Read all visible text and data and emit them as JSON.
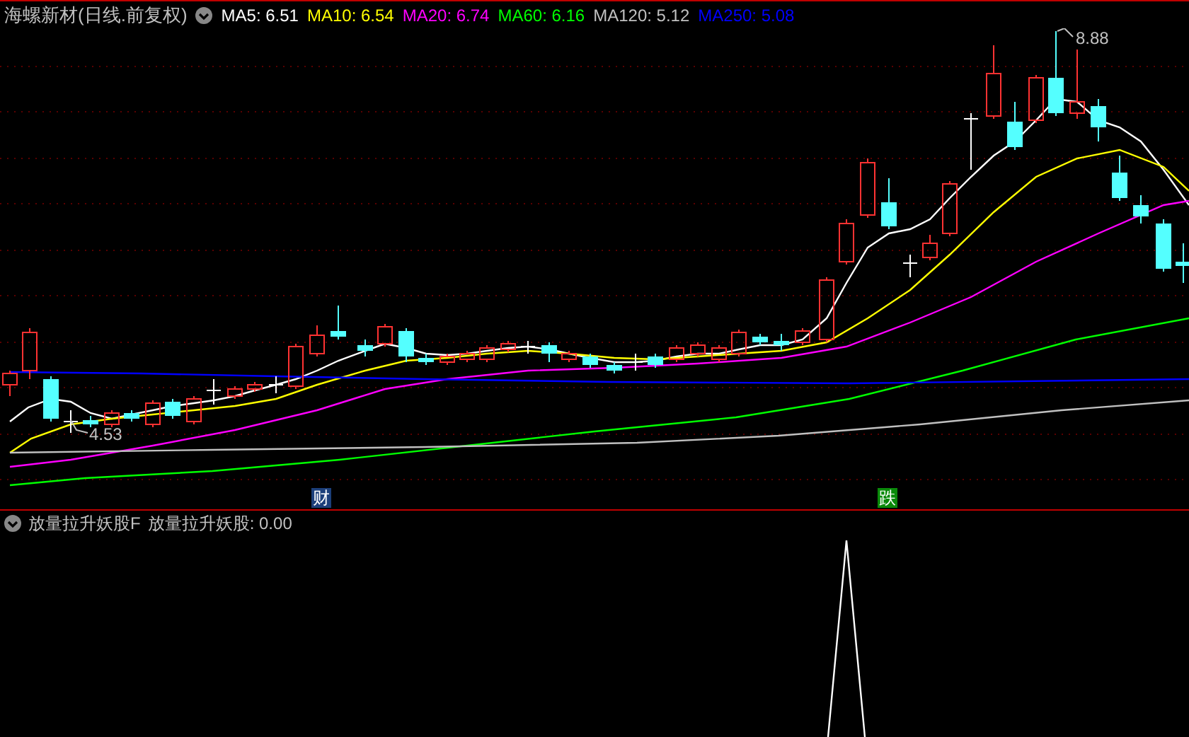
{
  "header": {
    "title": "海螺新材(日线.前复权)",
    "ma": [
      {
        "label": "MA5: 6.51",
        "color": "#ffffff"
      },
      {
        "label": "MA10: 6.54",
        "color": "#ffff00"
      },
      {
        "label": "MA20: 6.74",
        "color": "#ff00ff"
      },
      {
        "label": "MA60: 6.16",
        "color": "#00ff00"
      },
      {
        "label": "MA120: 5.12",
        "color": "#c0c0c0"
      },
      {
        "label": "MA250: 5.08",
        "color": "#0000ff"
      }
    ]
  },
  "chart": {
    "high_label": "8.88",
    "low_label": "4.53",
    "markers": [
      {
        "text": "财",
        "kind": "finance"
      },
      {
        "text": "跌",
        "kind": "fall"
      }
    ]
  },
  "indicator": {
    "name": "放量拉升妖股F",
    "reading": "放量拉升妖股: 0.00"
  }
}
